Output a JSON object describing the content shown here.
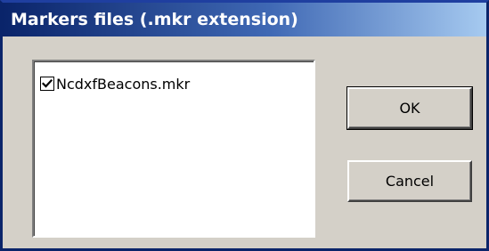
{
  "window": {
    "title": "Markers files (.mkr extension)"
  },
  "file_list": {
    "items": [
      {
        "label": "NcdxfBeacons.mkr",
        "checked": true
      }
    ]
  },
  "buttons": {
    "ok_label": "OK",
    "cancel_label": "Cancel"
  },
  "colors": {
    "title_gradient_start": "#0a246a",
    "title_gradient_end": "#a6caf0",
    "dialog_face": "#d4d0c8"
  }
}
